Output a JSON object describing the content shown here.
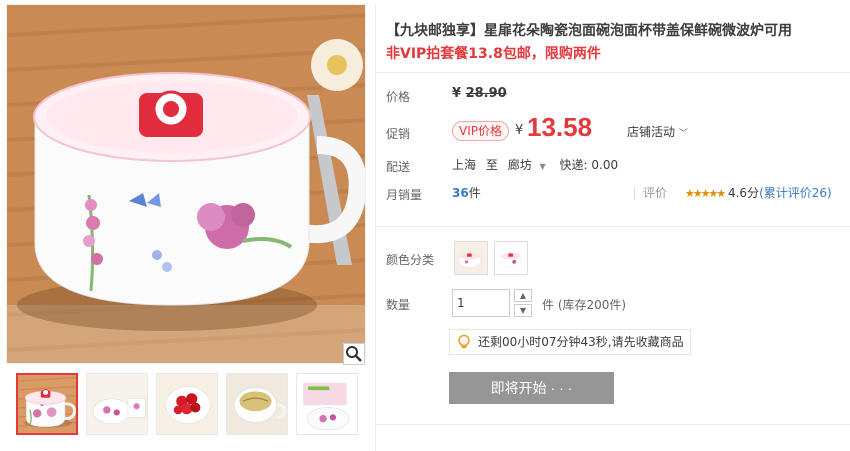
{
  "product": {
    "title": "【九块邮独享】星扉花朵陶瓷泡面碗泡面杯带盖保鲜碗微波炉可用",
    "subtitle": "非VIP拍套餐13.8包邮，限购两件"
  },
  "price": {
    "label": "价格",
    "currency": "¥",
    "original": "28.90"
  },
  "promo": {
    "label": "促销",
    "vip_badge": "VIP价格",
    "currency": "¥",
    "price": "13.58",
    "shop_activity": "店铺活动"
  },
  "delivery": {
    "label": "配送",
    "from": "上海",
    "to_word": "至",
    "to": "廊坊",
    "express": "快递: 0.00"
  },
  "sales": {
    "label": "月销量",
    "count": "36",
    "unit": "件",
    "rating_label": "评价",
    "stars": "★★★★★",
    "score": "4.6分",
    "reviews": "(累计评价26)"
  },
  "options": {
    "color_label": "颜色分类",
    "qty_label": "数量",
    "qty_value": "1",
    "stock": "件 (库存200件)"
  },
  "countdown": {
    "text": "还剩00小时07分钟43秒,请先收藏商品"
  },
  "buy": {
    "start_label": "即将开始 · · ·"
  },
  "icons": {
    "zoom": "magnifier-icon",
    "stepper_up": "chevron-up-icon",
    "stepper_down": "chevron-down-icon",
    "tip": "lightbulb-icon"
  },
  "colors": {
    "accent": "#e4393c",
    "link": "#3c7ac3",
    "button": "#969696",
    "star": "#e48b00"
  }
}
